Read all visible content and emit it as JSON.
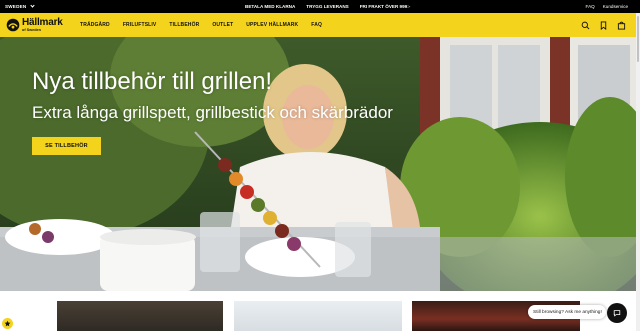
{
  "topbar": {
    "region": "SWEDEN",
    "usps": [
      "BETALA MED KLARNA",
      "TRYGG LEVERANS",
      "FRI FRAKT ÖVER 999:-"
    ],
    "faq": "FAQ",
    "customer_service": "Kundservice"
  },
  "nav": {
    "logo_brand": "Hällmark",
    "logo_sub": "of Sweden",
    "menu": [
      "TRÄDGÅRD",
      "FRILUFTSLIV",
      "TILLBEHÖR",
      "OUTLET",
      "UPPLEV HÄLLMARK",
      "FAQ"
    ],
    "icons": [
      "search-icon",
      "bookmark-icon",
      "shopping-bag-icon"
    ]
  },
  "hero": {
    "title": "Nya tillbehör till grillen!",
    "subtitle": "Extra långa grillspett, grillbestick och skärbrädor",
    "cta": "SE TILLBEHÖR"
  },
  "chat": {
    "prompt": "Still browsing? Ask me anything!"
  },
  "colors": {
    "brand_yellow": "#f3d31c",
    "topbar_bg": "#000000",
    "text_dark": "#111111"
  }
}
